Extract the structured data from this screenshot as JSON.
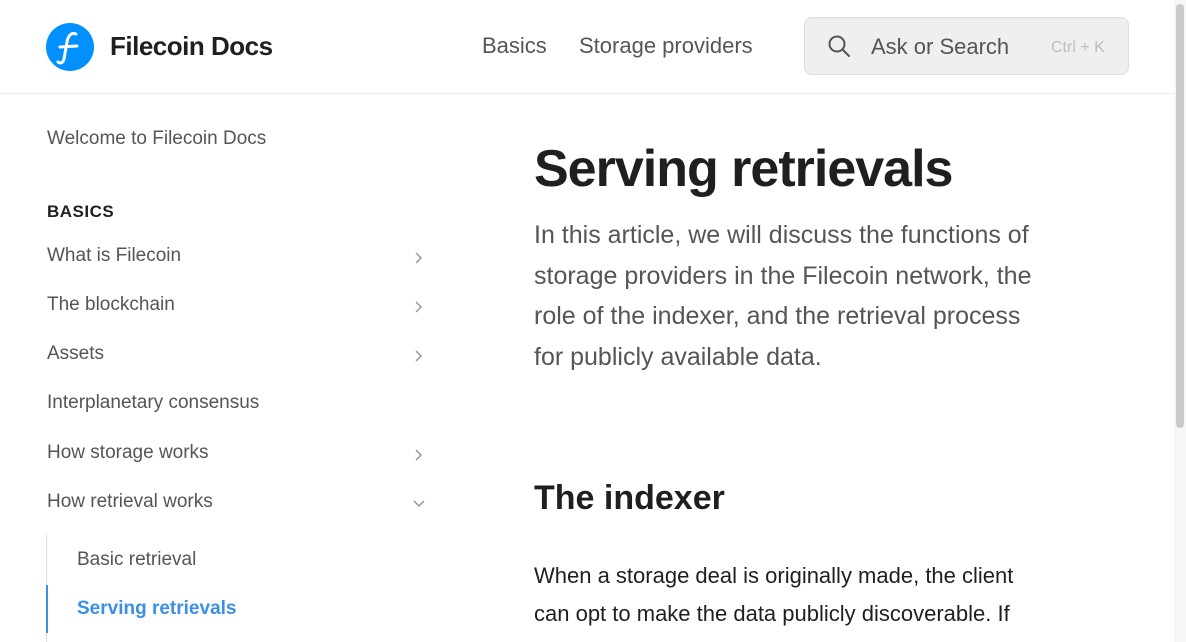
{
  "header": {
    "brand": "Filecoin Docs",
    "logo_icon": "filecoin-logo",
    "nav": [
      "Basics",
      "Storage providers"
    ],
    "search": {
      "placeholder": "Ask or Search",
      "shortcut": "Ctrl + K",
      "icon": "search-icon"
    }
  },
  "sidebar": {
    "welcome": "Welcome to Filecoin Docs",
    "section": "BASICS",
    "items": [
      {
        "label": "What is Filecoin",
        "icon": "chevron-right-icon"
      },
      {
        "label": "The blockchain",
        "icon": "chevron-right-icon"
      },
      {
        "label": "Assets",
        "icon": "chevron-right-icon"
      },
      {
        "label": "Interplanetary consensus"
      },
      {
        "label": "How storage works",
        "icon": "chevron-right-icon"
      },
      {
        "label": "How retrieval works",
        "icon": "chevron-down-icon"
      }
    ],
    "subitems": [
      {
        "label": "Basic retrieval"
      },
      {
        "label": "Serving retrievals",
        "active": true
      }
    ]
  },
  "main": {
    "title": "Serving retrievals",
    "lead": "In this article, we will discuss the functions of storage providers in the Filecoin network, the role of the indexer, and the retrieval process for publicly available data.",
    "h2": "The indexer",
    "para": "When a storage deal is originally made, the client can opt to make the data publicly discoverable. If this is the case, the storage"
  },
  "colors": {
    "accent": "#3b8fe6",
    "logo": "#0090ff"
  }
}
